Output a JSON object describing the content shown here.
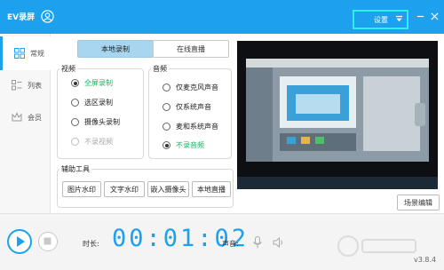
{
  "app": {
    "title": "EV录屏",
    "settings_label": "设置",
    "version": "v3.8.4",
    "accent": "#1da1ef",
    "highlight": "#2ef0f4"
  },
  "sidebar": {
    "items": [
      {
        "label": "常规",
        "icon": "grid-icon",
        "active": true
      },
      {
        "label": "列表",
        "icon": "list-icon",
        "active": false
      },
      {
        "label": "会员",
        "icon": "crown-icon",
        "active": false
      }
    ]
  },
  "modes": {
    "local_label": "本地录制",
    "online_label": "在线直播",
    "selected": "本地录制"
  },
  "video": {
    "title": "视频",
    "options": [
      {
        "label": "全屏录制",
        "checked": true,
        "disabled": false,
        "highlight": true
      },
      {
        "label": "选区录制",
        "checked": false,
        "disabled": false,
        "highlight": false
      },
      {
        "label": "摄像头录制",
        "checked": false,
        "disabled": false,
        "highlight": false
      },
      {
        "label": "不录视频",
        "checked": false,
        "disabled": true,
        "highlight": false
      }
    ]
  },
  "audio": {
    "title": "音频",
    "options": [
      {
        "label": "仅麦克风声音",
        "checked": false,
        "highlight": false
      },
      {
        "label": "仅系统声音",
        "checked": false,
        "highlight": false
      },
      {
        "label": "麦和系统声音",
        "checked": false,
        "highlight": false
      },
      {
        "label": "不录音频",
        "checked": true,
        "highlight": true
      }
    ]
  },
  "tools": {
    "title": "辅助工具",
    "buttons": [
      "图片水印",
      "文字水印",
      "嵌入摄像头",
      "本地直播"
    ]
  },
  "preview": {
    "scene_edit_label": "场景编辑"
  },
  "bottom": {
    "duration_label": "时长:",
    "timer": "00:01:02",
    "sound_label": "声音:"
  }
}
